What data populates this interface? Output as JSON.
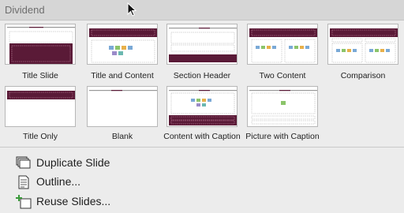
{
  "header": {
    "title": "Dividend"
  },
  "layouts": [
    {
      "id": "title-slide",
      "label": "Title Slide"
    },
    {
      "id": "title-and-content",
      "label": "Title and Content"
    },
    {
      "id": "section-header",
      "label": "Section Header"
    },
    {
      "id": "two-content",
      "label": "Two Content"
    },
    {
      "id": "comparison",
      "label": "Comparison"
    },
    {
      "id": "title-only",
      "label": "Title Only"
    },
    {
      "id": "blank",
      "label": "Blank"
    },
    {
      "id": "content-with-caption",
      "label": "Content with Caption"
    },
    {
      "id": "picture-with-caption",
      "label": "Picture with Caption"
    }
  ],
  "menu": [
    {
      "id": "duplicate-slide",
      "label": "Duplicate Slide",
      "icon": "duplicate-slide-icon"
    },
    {
      "id": "outline",
      "label": "Outline...",
      "icon": "outline-icon"
    },
    {
      "id": "reuse-slides",
      "label": "Reuse Slides...",
      "icon": "reuse-slides-icon"
    }
  ],
  "colors": {
    "accent": "#5a1a37",
    "header_bg": "#d6d6d6",
    "panel_bg": "#ececec"
  }
}
